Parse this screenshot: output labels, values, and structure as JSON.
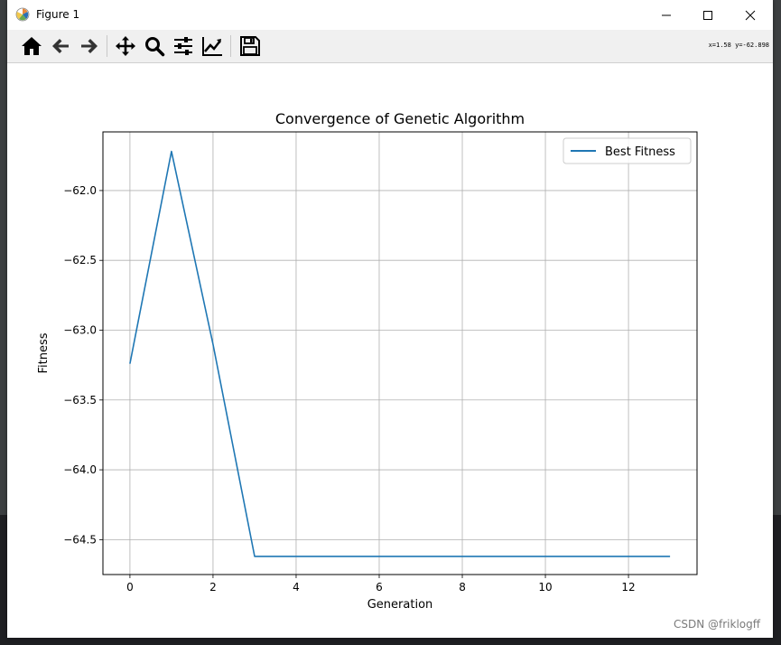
{
  "window": {
    "title": "Figure 1",
    "coords_readout": "x=1.58 y=-62.898"
  },
  "toolbar": {
    "buttons": [
      {
        "name": "home-icon"
      },
      {
        "name": "back-arrow-icon"
      },
      {
        "name": "forward-arrow-icon"
      },
      {
        "name": "pan-icon"
      },
      {
        "name": "zoom-icon"
      },
      {
        "name": "configure-subplots-icon"
      },
      {
        "name": "edit-axis-icon"
      },
      {
        "name": "save-icon"
      }
    ]
  },
  "watermark": "CSDN @friklogff",
  "colors": {
    "series": "#1f77b4",
    "grid": "#b0b0b0"
  },
  "chart_data": {
    "type": "line",
    "title": "Convergence of Genetic Algorithm",
    "xlabel": "Generation",
    "ylabel": "Fitness",
    "xlim": [
      -0.65,
      13.65
    ],
    "ylim": [
      -64.75,
      -61.58
    ],
    "xticks": [
      0,
      2,
      4,
      6,
      8,
      10,
      12
    ],
    "xtick_labels": [
      "0",
      "2",
      "4",
      "6",
      "8",
      "10",
      "12"
    ],
    "yticks": [
      -62.0,
      -62.5,
      -63.0,
      -63.5,
      -64.0,
      -64.5
    ],
    "ytick_labels": [
      "−62.0",
      "−62.5",
      "−63.0",
      "−63.5",
      "−64.0",
      "−64.5"
    ],
    "grid": true,
    "legend_position": "top-right",
    "series": [
      {
        "name": "Best Fitness",
        "x": [
          0,
          1,
          2,
          3,
          4,
          5,
          6,
          7,
          8,
          9,
          10,
          11,
          12,
          13
        ],
        "y": [
          -63.24,
          -61.72,
          -63.1,
          -64.62,
          -64.62,
          -64.62,
          -64.62,
          -64.62,
          -64.62,
          -64.62,
          -64.62,
          -64.62,
          -64.62,
          -64.62
        ]
      }
    ]
  }
}
